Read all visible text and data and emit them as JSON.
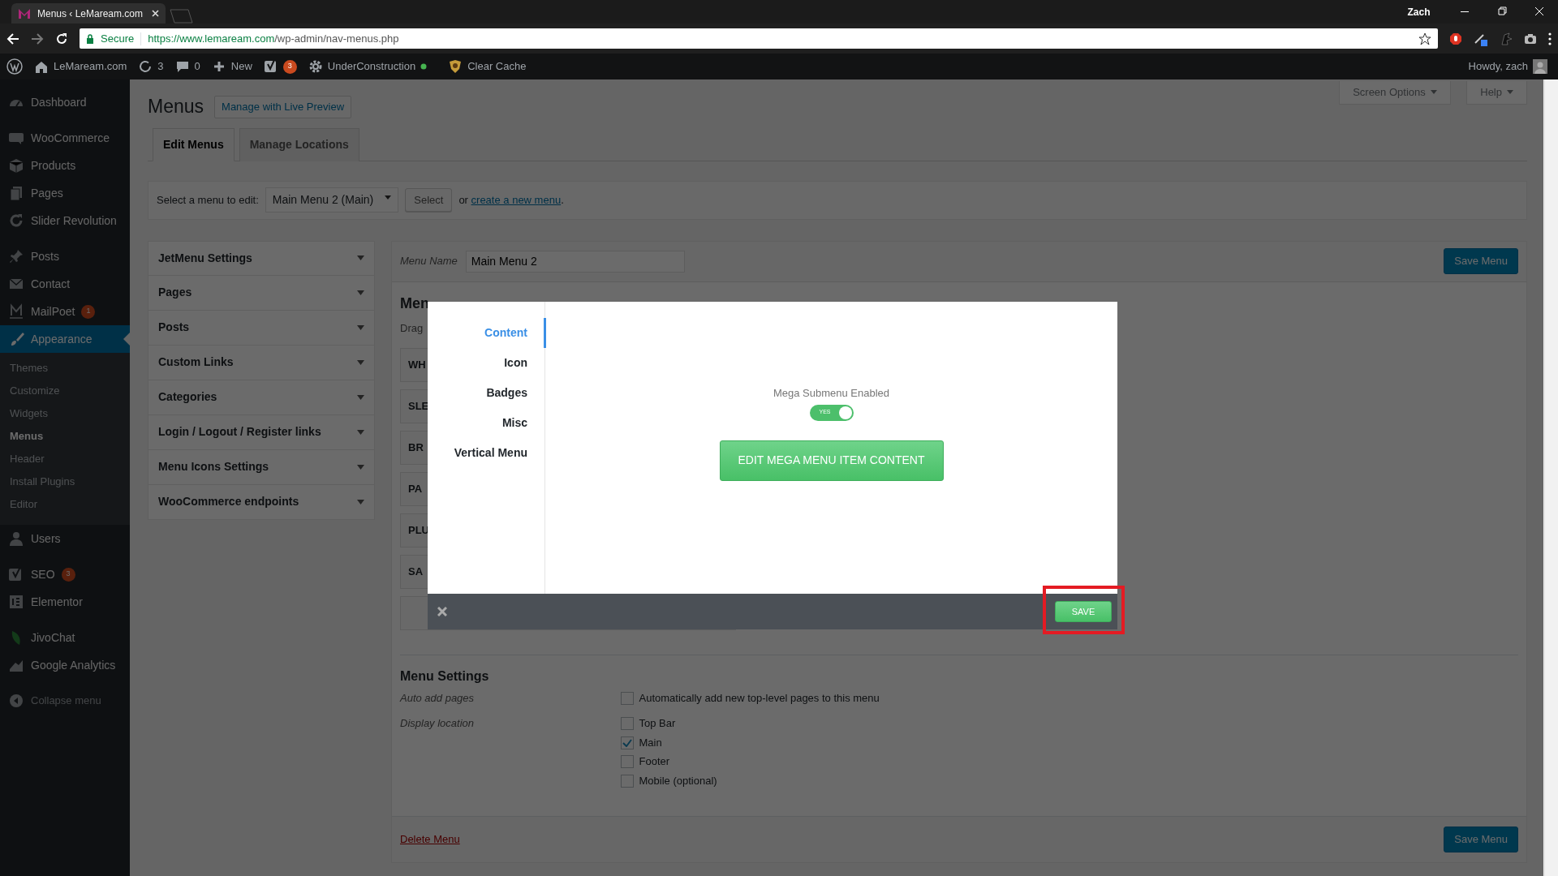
{
  "browser": {
    "tab_title": "Menus ‹ LeMaream.com",
    "secure_label": "Secure",
    "url_host": "https://www.lemaream.com",
    "url_path": "/wp-admin/nav-menus.php",
    "profile": "Zach"
  },
  "admin_bar": {
    "site": "LeMaream.com",
    "updates": "3",
    "comments": "0",
    "new": "New",
    "seo_count": "3",
    "maintenance": "UnderConstruction",
    "clear_cache": "Clear Cache",
    "greeting": "Howdy, zach"
  },
  "sidebar": {
    "groups": [
      [
        {
          "label": "Dashboard",
          "selected": false
        }
      ],
      [
        {
          "label": "WooCommerce",
          "selected": false
        },
        {
          "label": "Products",
          "selected": false
        },
        {
          "label": "Pages",
          "selected": false
        },
        {
          "label": "Slider Revolution",
          "selected": false
        }
      ],
      [
        {
          "label": "Posts",
          "selected": false
        },
        {
          "label": "Contact",
          "selected": false
        },
        {
          "label": "MailPoet",
          "badge": "1",
          "selected": false
        },
        {
          "label": "Appearance",
          "selected": true,
          "children": [
            {
              "label": "Themes",
              "selected": false
            },
            {
              "label": "Customize",
              "selected": false
            },
            {
              "label": "Widgets",
              "selected": false
            },
            {
              "label": "Menus",
              "selected": true
            },
            {
              "label": "Header",
              "selected": false
            },
            {
              "label": "Install Plugins",
              "selected": false
            },
            {
              "label": "Editor",
              "selected": false
            }
          ]
        }
      ],
      [
        {
          "label": "Users",
          "selected": false
        }
      ],
      [
        {
          "label": "SEO",
          "badge": "3",
          "selected": false
        },
        {
          "label": "Elementor",
          "selected": false
        }
      ],
      [
        {
          "label": "JivoChat",
          "selected": false
        },
        {
          "label": "Google Analytics",
          "selected": false
        }
      ]
    ],
    "collapse": "Collapse menu"
  },
  "screen_meta": [
    "Screen Options",
    "Help"
  ],
  "page": {
    "title": "Menus",
    "live_preview": "Manage with Live Preview",
    "tabs": [
      {
        "label": "Edit Menus",
        "selected": true
      },
      {
        "label": "Manage Locations",
        "selected": false
      }
    ],
    "select_bar": {
      "label": "Select a menu to edit:",
      "value": "Main Menu 2 (Main)",
      "button": "Select",
      "prefix": "or ",
      "link": "create a new menu",
      "suffix": "."
    },
    "accordion": [
      "JetMenu Settings",
      "Pages",
      "Posts",
      "Custom Links",
      "Categories",
      "Login / Logout / Register links",
      "Menu Icons Settings",
      "WooCommerce endpoints"
    ],
    "menu_name_label": "Menu Name",
    "menu_name_value": "Main Menu 2",
    "save_menu": "Save Menu",
    "structure_heading": "Men",
    "drag_text": "Drag",
    "menu_items": [
      "WH",
      "SLE",
      "BR",
      "PA",
      "PLU",
      "SA"
    ],
    "settings": {
      "heading": "Menu Settings",
      "rows": [
        {
          "label": "Auto add pages",
          "options": [
            {
              "label": "Automatically add new top-level pages to this menu",
              "checked": false
            }
          ]
        },
        {
          "label": "Display location",
          "options": [
            {
              "label": "Top Bar",
              "checked": false
            },
            {
              "label": "Main",
              "checked": true
            },
            {
              "label": "Footer",
              "checked": false
            },
            {
              "label": "Mobile (optional)",
              "checked": false
            }
          ]
        }
      ]
    },
    "delete_menu": "Delete Menu",
    "save_menu_bottom": "Save Menu"
  },
  "modal": {
    "nav": [
      {
        "label": "Content",
        "selected": true
      },
      {
        "label": "Icon",
        "selected": false
      },
      {
        "label": "Badges",
        "selected": false
      },
      {
        "label": "Misc",
        "selected": false
      },
      {
        "label": "Vertical Menu",
        "selected": false
      }
    ],
    "toggle_label": "Mega Submenu Enabled",
    "toggle": {
      "on": true,
      "text": "YES"
    },
    "edit_button": "EDIT MEGA MENU ITEM CONTENT",
    "save": "SAVE",
    "save_highlighted": true
  }
}
